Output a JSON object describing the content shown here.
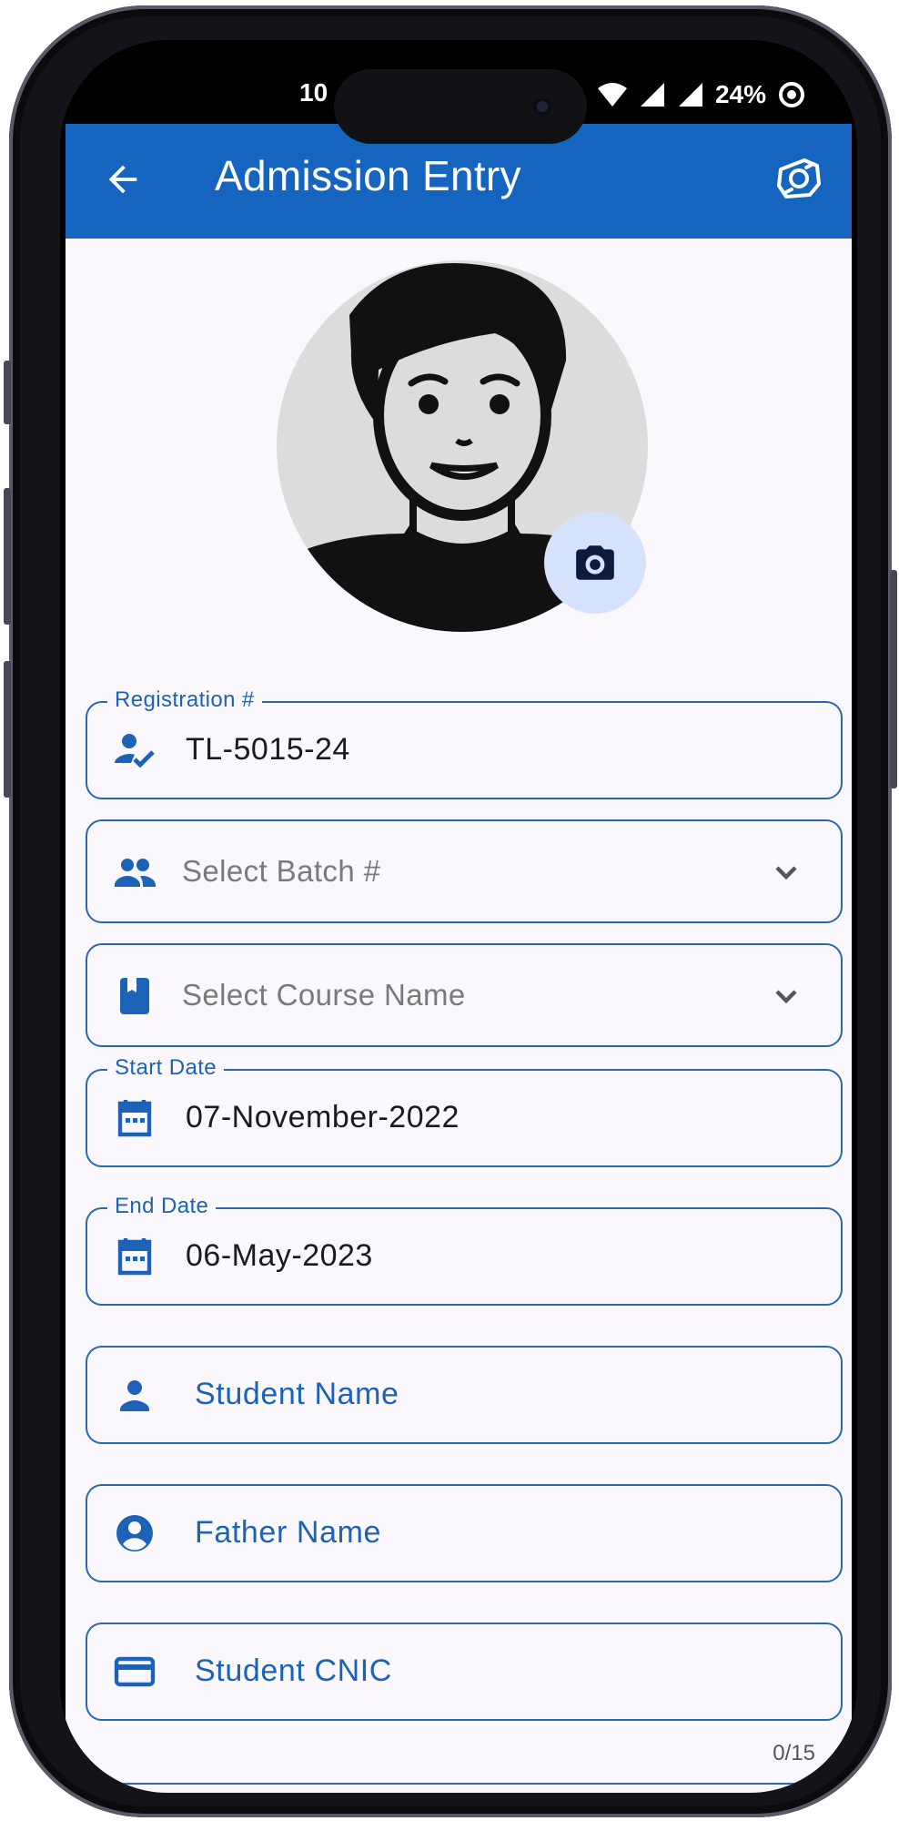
{
  "status_bar": {
    "time": "10",
    "battery": "24%"
  },
  "app_bar": {
    "title": "Admission Entry"
  },
  "fields": {
    "registration": {
      "label": "Registration #",
      "value": "TL-5015-24"
    },
    "batch": {
      "placeholder": "Select Batch #"
    },
    "course": {
      "placeholder": "Select Course Name"
    },
    "start_date": {
      "label": "Start Date",
      "value": "07-November-2022"
    },
    "end_date": {
      "label": "End Date",
      "value": "06-May-2023"
    },
    "student_name": {
      "hint": "Student Name"
    },
    "father_name": {
      "hint": "Father Name"
    },
    "student_cnic": {
      "hint": "Student CNIC",
      "counter": "0/15"
    }
  },
  "colors": {
    "primary": "#1565c0",
    "accent_text": "#1c63b7",
    "fab": "#d6e2fb",
    "background": "#fbf8fd"
  }
}
